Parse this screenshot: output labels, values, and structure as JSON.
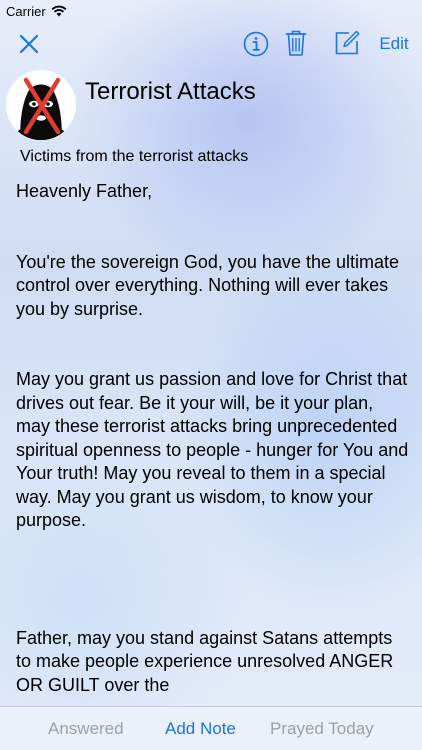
{
  "status_bar": {
    "carrier": "Carrier"
  },
  "nav": {
    "edit_label": "Edit",
    "icons": [
      "close-icon",
      "info-icon",
      "trash-icon",
      "compose-icon"
    ],
    "accent_color": "#1a73e8"
  },
  "prayer": {
    "title": "Terrorist Attacks",
    "subtitle": "Victims from the terrorist attacks",
    "paragraphs": [
      "Heavenly Father,",
      "You're the sovereign God, you have the ultimate control over everything. Nothing will ever takes you by surprise.",
      "May you grant us passion and love for Christ that drives out fear. Be it your will, be it your plan, may these terrorist attacks bring unprecedented spiritual openness to people - hunger for You and Your truth! May you reveal to them in a special way. May you grant us wisdom, to know your purpose.",
      "Father, may you stand against Satans attempts to make people experience unresolved ANGER OR GUILT over the"
    ]
  },
  "tabs": {
    "answered": "Answered",
    "add_note": "Add Note",
    "prayed_today": "Prayed Today"
  }
}
